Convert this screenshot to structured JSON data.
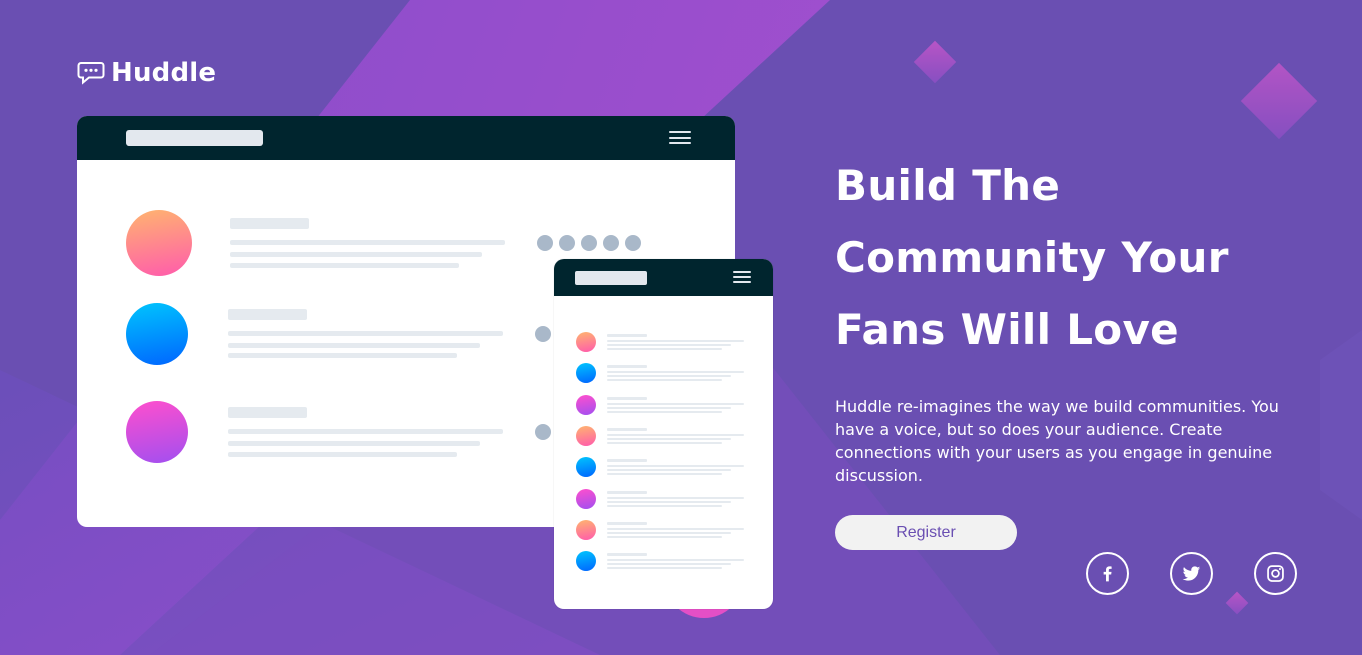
{
  "brand": {
    "name": "Huddle",
    "accent_color": "#6a4fb2",
    "logo_icon": "chat-bubble-icon"
  },
  "hero": {
    "headline_lines": [
      "Build The",
      "Community Your",
      "Fans Will Love"
    ],
    "description": "Huddle re-imagines the way we build communities. You have a voice, but so does your audience. Create connections with your users as you engage in genuine discussion.",
    "cta_label": "Register"
  },
  "social_links": [
    {
      "name": "facebook",
      "icon": "facebook-icon"
    },
    {
      "name": "twitter",
      "icon": "twitter-icon"
    },
    {
      "name": "instagram",
      "icon": "instagram-icon"
    }
  ],
  "mockup": {
    "desktop_avatar_colors": [
      [
        "#ffb46f",
        "#ff5bac"
      ],
      [
        "#00c5fd",
        "#0065ff"
      ],
      [
        "#ff4fcd",
        "#a24ff0"
      ]
    ],
    "mobile_avatar_colors": [
      [
        "#ffb46f",
        "#ff5bac"
      ],
      [
        "#00c5fd",
        "#0065ff"
      ],
      [
        "#ff4fcd",
        "#a24ff0"
      ],
      [
        "#ffb46f",
        "#ff5bac"
      ],
      [
        "#00c5fd",
        "#0065ff"
      ],
      [
        "#ff4fcd",
        "#a24ff0"
      ],
      [
        "#ffb46f",
        "#ff5bac"
      ],
      [
        "#00c5fd",
        "#0065ff"
      ]
    ]
  }
}
